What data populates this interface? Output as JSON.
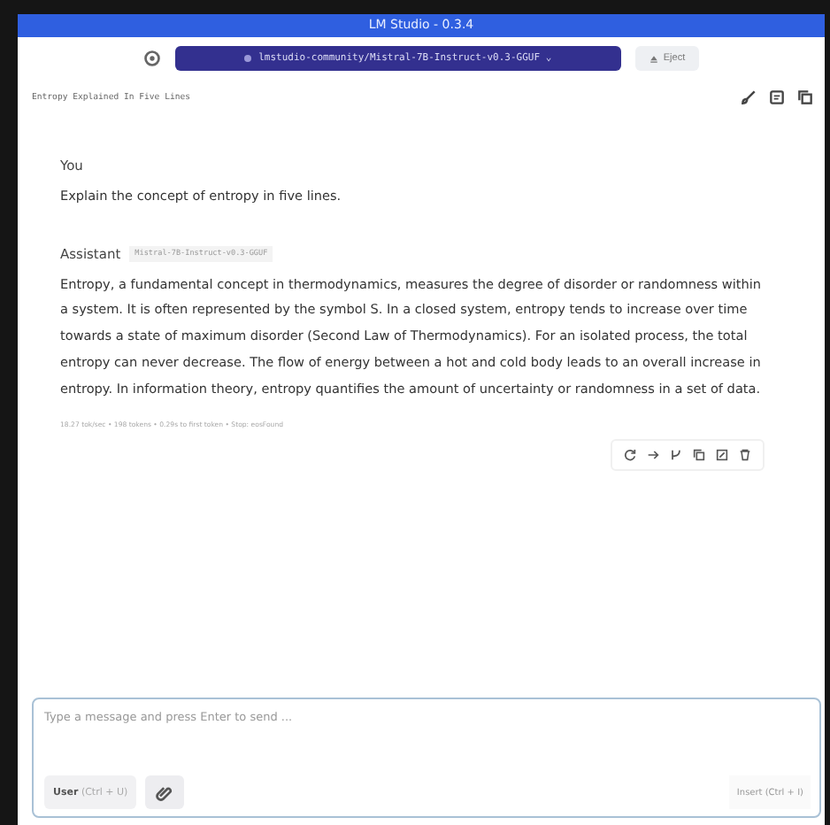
{
  "window": {
    "title": "LM Studio - 0.3.4"
  },
  "toolbar": {
    "model": "lmstudio-community/Mistral-7B-Instruct-v0.3-GGUF",
    "model_caret": "⌄",
    "eject": "Eject"
  },
  "chat": {
    "title": "Entropy Explained In Five Lines"
  },
  "messages": [
    {
      "role": "You",
      "text": "Explain the concept of entropy in five lines."
    },
    {
      "role": "Assistant",
      "model_tag": "Mistral-7B-Instruct-v0.3-GGUF",
      "text": "Entropy, a fundamental concept in thermodynamics, measures the degree of disorder or randomness within a system. It is often represented by the symbol S. In a closed system, entropy tends to increase over time towards a state of maximum disorder (Second Law of Thermodynamics). For an isolated process, the total entropy can never decrease. The flow of energy between a hot and cold body leads to an overall increase in entropy. In information theory, entropy quantifies the amount of uncertainty or randomness in a set of data.",
      "stats": "18.27 tok/sec • 198 tokens • 0.29s to first token • Stop: eosFound"
    }
  ],
  "composer": {
    "placeholder": "Type a message and press Enter to send ...",
    "role_button": "User",
    "role_shortcut": "(Ctrl + U)",
    "insert_button": "Insert",
    "insert_shortcut": "(Ctrl + I)"
  }
}
